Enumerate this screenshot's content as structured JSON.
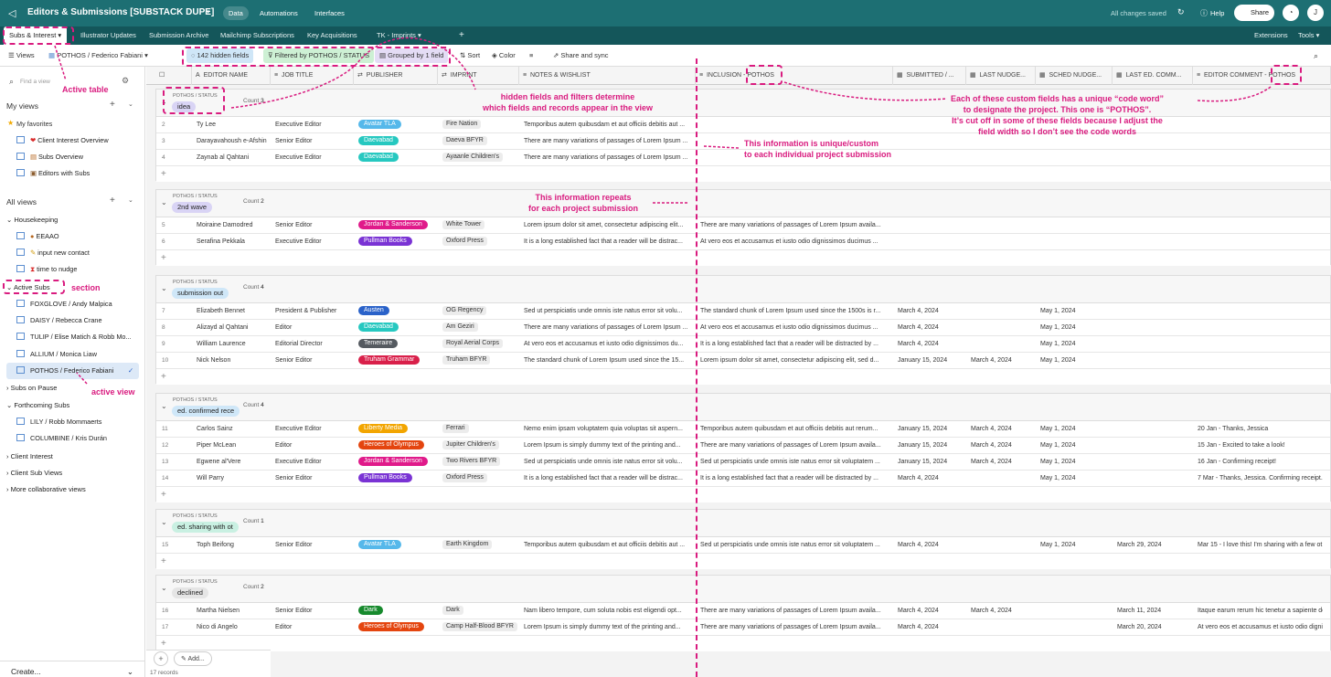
{
  "app": {
    "title": "Editors & Submissions [SUBSTACK DUPE]",
    "nav": [
      "Data",
      "Automations",
      "Interfaces"
    ],
    "saved": "All changes saved",
    "help": "Help",
    "share": "Share",
    "avatar": "J"
  },
  "tabs": [
    "Subs & Interest",
    "Illustrator Updates",
    "Submission Archive",
    "Mailchimp Subscriptions",
    "Key Acquisitions",
    "TK - Imprints"
  ],
  "tabs_right": [
    "Extensions",
    "Tools"
  ],
  "toolbar": {
    "views": "Views",
    "current_view": "POTHOS / Federico Fabiani",
    "hidden": "142 hidden fields",
    "filtered": "Filtered by POTHOS / STATUS",
    "grouped": "Grouped by 1 field",
    "sort": "Sort",
    "color": "Color",
    "share_sync": "Share and sync"
  },
  "sidebar": {
    "find": "Find a view",
    "my_views": "My views",
    "my_favorites": "My favorites",
    "favorites": [
      "Client Interest Overview",
      "Subs Overview",
      "Editors with Subs"
    ],
    "all_views": "All views",
    "housekeeping": "Housekeeping",
    "housekeeping_items": [
      "EEAAO",
      "input new contact",
      "time to nudge"
    ],
    "active_subs": "Active Subs",
    "active_items": [
      "FOXGLOVE / Andy Malpica",
      "DAISY / Rebecca Crane",
      "TULIP / Elise Matich & Robb Mo...",
      "ALLIUM / Monica Liaw",
      "POTHOS / Federico Fabiani"
    ],
    "subs_on_pause": "Subs on Pause",
    "forthcoming": "Forthcoming Subs",
    "forthcoming_items": [
      "LILY / Robb Mommaerts",
      "COLUMBINE / Kris Durán"
    ],
    "client_interest": "Client Interest",
    "client_sub_views": "Client Sub Views",
    "more": "More collaborative views",
    "create": "Create..."
  },
  "columns": [
    "EDITOR NAME",
    "JOB TITLE",
    "PUBLISHER",
    "IMPRINT",
    "NOTES & WISHLIST",
    "INCLUSION - POTHOS",
    "SUBMITTED / ...",
    "LAST NUDGE...",
    "SCHED NUDGE...",
    "LAST ED. COMM...",
    "EDITOR COMMENT - POTHOS"
  ],
  "group_field": "POTHOS / STATUS",
  "count_label": "Count",
  "groups": [
    {
      "label": "idea",
      "count": "3",
      "color": "#d9d4f5",
      "rows": [
        {
          "n": "2",
          "name": "Ty Lee",
          "job": "Executive Editor",
          "pub": "Avatar TLA",
          "pubc": "#55b8ea",
          "imp": "Fire Nation",
          "notes": "Temporibus autem quibusdam et aut officiis debitis aut ...",
          "incl": "",
          "sub": "",
          "ln": "",
          "sn": "",
          "lec": "",
          "ec": ""
        },
        {
          "n": "3",
          "name": "Darayavahoush e-Afshin",
          "job": "Senior Editor",
          "pub": "Daevabad",
          "pubc": "#26c8c0",
          "imp": "Daeva BFYR",
          "notes": "There are many variations of passages of Lorem Ipsum ...",
          "incl": "",
          "sub": "",
          "ln": "",
          "sn": "",
          "lec": "",
          "ec": ""
        },
        {
          "n": "4",
          "name": "Zaynab al Qahtani",
          "job": "Executive Editor",
          "pub": "Daevabad",
          "pubc": "#26c8c0",
          "imp": "Ayaanle Children's",
          "notes": "There are many variations of passages of Lorem Ipsum ...",
          "incl": "",
          "sub": "",
          "ln": "",
          "sn": "",
          "lec": "",
          "ec": ""
        }
      ]
    },
    {
      "label": "2nd wave",
      "count": "2",
      "color": "#d9d4f5",
      "rows": [
        {
          "n": "5",
          "name": "Moiraine Damodred",
          "job": "Senior Editor",
          "pub": "Jordan & Sanderson",
          "pubc": "#e01a8a",
          "imp": "White Tower",
          "notes": "Lorem ipsum dolor sit amet, consectetur adipiscing elit...",
          "incl": "There are many variations of passages of Lorem Ipsum availa...",
          "sub": "",
          "ln": "",
          "sn": "",
          "lec": "",
          "ec": ""
        },
        {
          "n": "6",
          "name": "Serafina Pekkala",
          "job": "Executive Editor",
          "pub": "Pullman Books",
          "pubc": "#7a33d4",
          "imp": "Oxford Press",
          "notes": "It is a long established fact that a reader will be distrac...",
          "incl": "At vero eos et accusamus et iusto odio dignissimos ducimus ...",
          "sub": "",
          "ln": "",
          "sn": "",
          "lec": "",
          "ec": ""
        }
      ]
    },
    {
      "label": "submission out",
      "count": "4",
      "color": "#cfe7f8",
      "rows": [
        {
          "n": "7",
          "name": "Elizabeth Bennet",
          "job": "President & Publisher",
          "pub": "Austen",
          "pubc": "#2a62c9",
          "imp": "OG Regency",
          "notes": "Sed ut perspiciatis unde omnis iste natus error sit volu...",
          "incl": "The standard chunk of Lorem Ipsum used since the 1500s is r...",
          "sub": "March 4, 2024",
          "ln": "",
          "sn": "May 1, 2024",
          "lec": "",
          "ec": ""
        },
        {
          "n": "8",
          "name": "Alizayd al Qahtani",
          "job": "Editor",
          "pub": "Daevabad",
          "pubc": "#26c8c0",
          "imp": "Am Geziri",
          "notes": "There are many variations of passages of Lorem Ipsum ...",
          "incl": "At vero eos et accusamus et iusto odio dignissimos ducimus ...",
          "sub": "March 4, 2024",
          "ln": "",
          "sn": "May 1, 2024",
          "lec": "",
          "ec": ""
        },
        {
          "n": "9",
          "name": "William Laurence",
          "job": "Editorial Director",
          "pub": "Temeraire",
          "pubc": "#555a60",
          "imp": "Royal Aerial Corps",
          "notes": "At vero eos et accusamus et iusto odio dignissimos du...",
          "incl": "It is a long established fact that a reader will be distracted by ...",
          "sub": "March 4, 2024",
          "ln": "",
          "sn": "May 1, 2024",
          "lec": "",
          "ec": ""
        },
        {
          "n": "10",
          "name": "Nick Nelson",
          "job": "Senior Editor",
          "pub": "Truham Grammar",
          "pubc": "#d9204a",
          "imp": "Truham BFYR",
          "notes": "The standard chunk of Lorem Ipsum used since the 15...",
          "incl": "Lorem ipsum dolor sit amet, consectetur adipiscing elit, sed d...",
          "sub": "January 15, 2024",
          "ln": "March 4, 2024",
          "sn": "May 1, 2024",
          "lec": "",
          "ec": ""
        }
      ]
    },
    {
      "label": "ed. confirmed rece",
      "count": "4",
      "color": "#cfe7f8",
      "rows": [
        {
          "n": "11",
          "name": "Carlos Sainz",
          "job": "Executive Editor",
          "pub": "Liberty Media",
          "pubc": "#f2a500",
          "imp": "Ferrari",
          "notes": "Nemo enim ipsam voluptatem quia voluptas sit aspern...",
          "incl": "Temporibus autem quibusdam et aut officiis debitis aut rerum...",
          "sub": "January 15, 2024",
          "ln": "March 4, 2024",
          "sn": "May 1, 2024",
          "lec": "",
          "ec": "20 Jan - Thanks, Jessica"
        },
        {
          "n": "12",
          "name": "Piper McLean",
          "job": "Editor",
          "pub": "Heroes of Olympus",
          "pubc": "#e4450f",
          "imp": "Jupiter Children's",
          "notes": "Lorem Ipsum is simply dummy text of the printing and...",
          "incl": "There are many variations of passages of Lorem Ipsum availa...",
          "sub": "January 15, 2024",
          "ln": "March 4, 2024",
          "sn": "May 1, 2024",
          "lec": "",
          "ec": "15 Jan - Excited to take a look!"
        },
        {
          "n": "13",
          "name": "Egwene al'Vere",
          "job": "Executive Editor",
          "pub": "Jordan & Sanderson",
          "pubc": "#e01a8a",
          "imp": "Two Rivers BFYR",
          "notes": "Sed ut perspiciatis unde omnis iste natus error sit volu...",
          "incl": "Sed ut perspiciatis unde omnis iste natus error sit voluptatem ...",
          "sub": "January 15, 2024",
          "ln": "March 4, 2024",
          "sn": "May 1, 2024",
          "lec": "",
          "ec": "16 Jan - Confirming receipt!"
        },
        {
          "n": "14",
          "name": "Will Parry",
          "job": "Senior Editor",
          "pub": "Pullman Books",
          "pubc": "#7a33d4",
          "imp": "Oxford Press",
          "notes": "It is a long established fact that a reader will be distrac...",
          "incl": "It is a long established fact that a reader will be distracted by ...",
          "sub": "March 4, 2024",
          "ln": "",
          "sn": "May 1, 2024",
          "lec": "",
          "ec": "7 Mar - Thanks, Jessica. Confirming receipt."
        }
      ]
    },
    {
      "label": "ed. sharing with ot",
      "count": "1",
      "color": "#c9f0e2",
      "rows": [
        {
          "n": "15",
          "name": "Toph Beifong",
          "job": "Senior Editor",
          "pub": "Avatar TLA",
          "pubc": "#55b8ea",
          "imp": "Earth Kingdom",
          "notes": "Temporibus autem quibusdam et aut officiis debitis aut ...",
          "incl": "Sed ut perspiciatis unde omnis iste natus error sit voluptatem ...",
          "sub": "March 4, 2024",
          "ln": "",
          "sn": "May 1, 2024",
          "lec": "March 29, 2024",
          "ec": "Mar 15 - I love this! I'm sharing with a few ot"
        }
      ]
    },
    {
      "label": "declined",
      "count": "2",
      "color": "#e5e5e5",
      "rows": [
        {
          "n": "16",
          "name": "Martha Nielsen",
          "job": "Senior Editor",
          "pub": "Dark",
          "pubc": "#178a2d",
          "imp": "Dark",
          "notes": "Nam libero tempore, cum soluta nobis est eligendi opt...",
          "incl": "There are many variations of passages of Lorem Ipsum availa...",
          "sub": "March 4, 2024",
          "ln": "March 4, 2024",
          "sn": "",
          "lec": "March 11, 2024",
          "ec": "Itaque earum rerum hic tenetur a sapiente de"
        },
        {
          "n": "17",
          "name": "Nico di Angelo",
          "job": "Editor",
          "pub": "Heroes of Olympus",
          "pubc": "#e4450f",
          "imp": "Camp Half-Blood BFYR",
          "notes": "Lorem Ipsum is simply dummy text of the printing and...",
          "incl": "There are many variations of passages of Lorem Ipsum availa...",
          "sub": "March 4, 2024",
          "ln": "",
          "sn": "",
          "lec": "March 20, 2024",
          "ec": "At vero eos et accusamus et iusto odio dignis"
        }
      ]
    }
  ],
  "footer": {
    "add": "Add...",
    "records": "17 records"
  },
  "annotations": {
    "active_table": "Active table",
    "section": "section",
    "active_view": "active view",
    "hidden": "hidden fields and filters determine\nwhich fields and records appear in the view",
    "codeword": "Each of these custom fields has a unique “code word”\nto designate the project. This one is “POTHOS”.\nIt’s cut off in some of these fields because I adjust the\nfield width so I don’t see the code words",
    "unique": "This information is unique/custom\nto each individual project submission",
    "repeats": "This information repeats\nfor each project submission"
  },
  "colors": {
    "accent": "#d91b7f",
    "topbar": "#1d6f73"
  }
}
